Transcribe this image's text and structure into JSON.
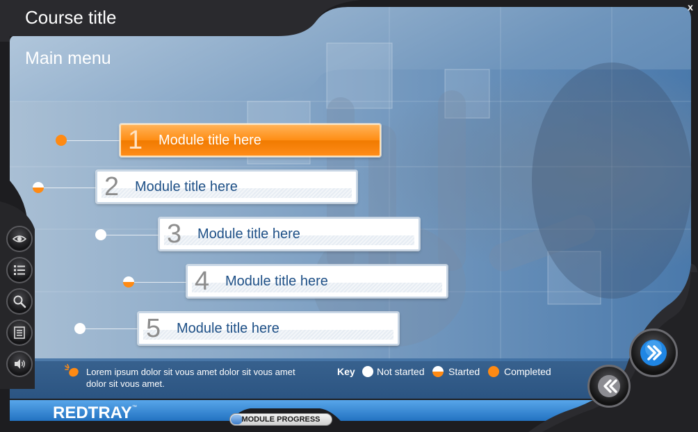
{
  "window": {
    "course_title": "Course title",
    "close_label": "x"
  },
  "page": {
    "title": "Main menu"
  },
  "modules": [
    {
      "number": "1",
      "label": "Module title here",
      "status": "completed",
      "active": true
    },
    {
      "number": "2",
      "label": "Module title here",
      "status": "started",
      "active": false
    },
    {
      "number": "3",
      "label": "Module title here",
      "status": "not_started",
      "active": false
    },
    {
      "number": "4",
      "label": "Module title here",
      "status": "started",
      "active": false
    },
    {
      "number": "5",
      "label": "Module title here",
      "status": "not_started",
      "active": false
    }
  ],
  "sidebar": {
    "buttons": [
      {
        "icon": "eye-icon"
      },
      {
        "icon": "menu-list-icon"
      },
      {
        "icon": "magnifier-icon"
      },
      {
        "icon": "notes-icon"
      },
      {
        "icon": "speaker-icon"
      }
    ]
  },
  "footer": {
    "info_text": "Lorem ipsum dolor sit vous amet dolor sit vous amet dolor sit vous amet.",
    "key": {
      "label": "Key",
      "not_started": "Not started",
      "started": "Started",
      "completed": "Completed"
    },
    "brand": "REDTRAY",
    "brand_tm": "™",
    "progress_label": "MODULE PROGRESS",
    "progress_fraction": 0.12
  },
  "navigation": {
    "next_icon": "double-chevron-right-icon",
    "back_icon": "double-chevron-left-icon"
  },
  "colors": {
    "accent": "#ff8a13",
    "primary_blue": "#1d4f86",
    "frame": "#1d1d20"
  }
}
